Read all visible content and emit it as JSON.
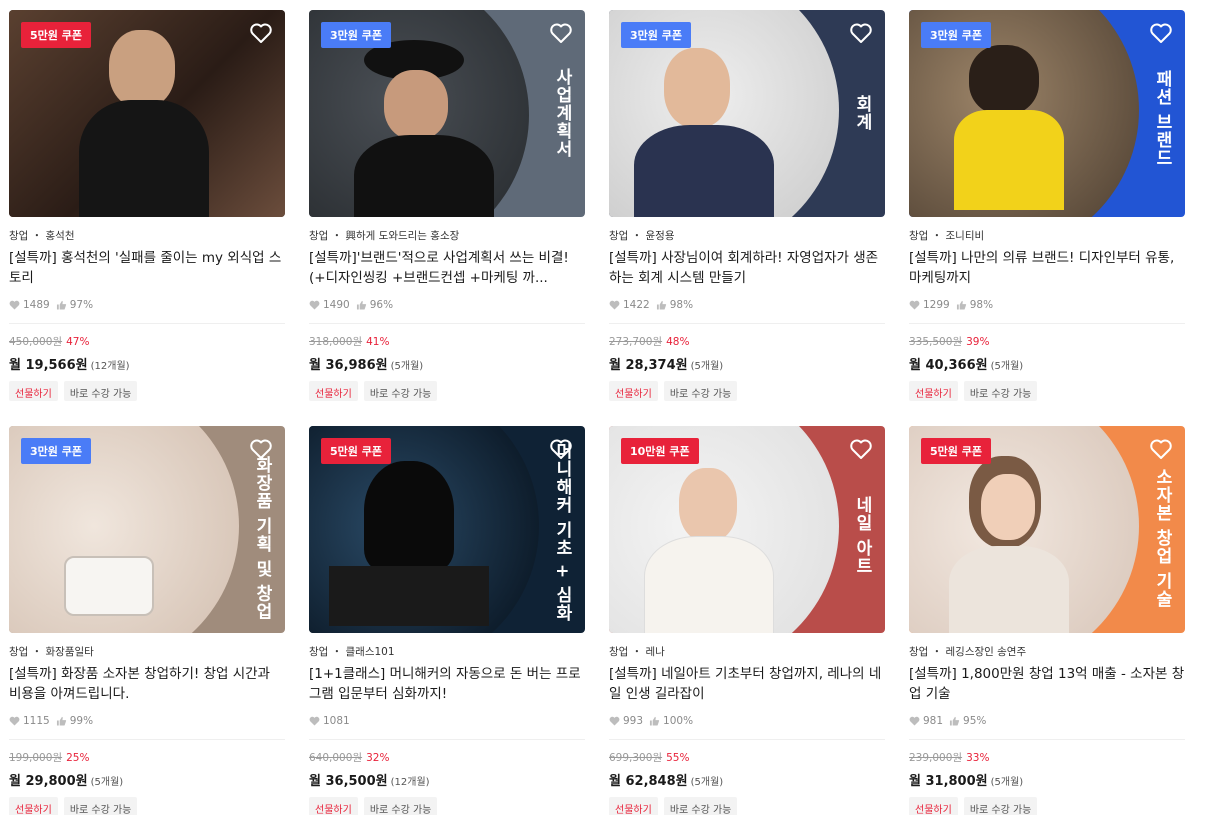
{
  "cards": [
    {
      "coupon": "5만원 쿠폰",
      "coupon_color": "#e8223a",
      "side_text": "",
      "meta": "창업 ・ 홍석천",
      "title": "[설특까] 홍석천의 '실패를 줄이는 my 외식업 스토리",
      "likes": "1489",
      "rating": "97%",
      "orig_price": "450,000원",
      "discount": "47%",
      "monthly": "월 19,566원",
      "months": "(12개월)",
      "gift": "선물하기",
      "now": "바로 수강 가능",
      "bg": "#3a2a22",
      "photo": "#6b4d3c"
    },
    {
      "coupon": "3만원 쿠폰",
      "coupon_color": "#4a7cf7",
      "side_text": "사업계획서",
      "meta": "창업 ・ 興하게 도와드리는 홍소장",
      "title": "[설특까]'브랜드'적으로 사업계획서 쓰는 비결! (+디자인씽킹 +브랜드컨셉 +마케팅 까...",
      "likes": "1490",
      "rating": "96%",
      "orig_price": "318,000원",
      "discount": "41%",
      "monthly": "월 36,986원",
      "months": "(5개월)",
      "gift": "선물하기",
      "now": "바로 수강 가능",
      "bg": "#5f6a78",
      "photo": "#2b2f33"
    },
    {
      "coupon": "3만원 쿠폰",
      "coupon_color": "#4a7cf7",
      "side_text": "회계",
      "meta": "창업 ・ 윤정용",
      "title": "[설특까] 사장님이여 회계하라! 자영업자가 생존하는 회계 시스템 만들기",
      "likes": "1422",
      "rating": "98%",
      "orig_price": "273,700원",
      "discount": "48%",
      "monthly": "월 28,374원",
      "months": "(5개월)",
      "gift": "선물하기",
      "now": "바로 수강 가능",
      "bg": "#2e3a55",
      "photo": "#d9d9d9"
    },
    {
      "coupon": "3만원 쿠폰",
      "coupon_color": "#4a7cf7",
      "side_text": "패션 브랜드",
      "meta": "창업 ・ 조니티비",
      "title": "[설특까] 나만의 의류 브랜드! 디자인부터 유통, 마케팅까지",
      "likes": "1299",
      "rating": "98%",
      "orig_price": "335,500원",
      "discount": "39%",
      "monthly": "월 40,366원",
      "months": "(5개월)",
      "gift": "선물하기",
      "now": "바로 수강 가능",
      "bg": "#2255d4",
      "photo": "#8a7258"
    },
    {
      "coupon": "3만원 쿠폰",
      "coupon_color": "#4a7cf7",
      "side_text": "화장품 기획 및 창업",
      "meta": "창업 ・ 화장품일타",
      "title": "[설특까] 화장품 소자본 창업하기! 창업 시간과 비용을 아껴드립니다.",
      "likes": "1115",
      "rating": "99%",
      "orig_price": "199,000원",
      "discount": "25%",
      "monthly": "월 29,800원",
      "months": "(5개월)",
      "gift": "선물하기",
      "now": "바로 수강 가능",
      "bg": "#a08c7c",
      "photo": "#e4d7cc"
    },
    {
      "coupon": "5만원 쿠폰",
      "coupon_color": "#e8223a",
      "side_text": "머니해커 기초 + 심화",
      "meta": "창업 ・ 클래스101",
      "title": "[1+1클래스] 머니해커의 자동으로 돈 버는 프로그램 입문부터 심화까지!",
      "likes": "1081",
      "rating": "",
      "orig_price": "640,000원",
      "discount": "32%",
      "monthly": "월 36,500원",
      "months": "(12개월)",
      "gift": "선물하기",
      "now": "바로 수강 가능",
      "bg": "#0f2235",
      "photo": "#1e3c55"
    },
    {
      "coupon": "10만원 쿠폰",
      "coupon_color": "#e8223a",
      "side_text": "네일 아트",
      "meta": "창업 ・ 레나",
      "title": "[설특까] 네일아트 기초부터 창업까지, 레나의 네일 인생 길라잡이",
      "likes": "993",
      "rating": "100%",
      "orig_price": "699,300원",
      "discount": "55%",
      "monthly": "월 62,848원",
      "months": "(5개월)",
      "gift": "선물하기",
      "now": "바로 수강 가능",
      "bg": "#b94d4a",
      "photo": "#eeeeee"
    },
    {
      "coupon": "5만원 쿠폰",
      "coupon_color": "#e8223a",
      "side_text": "소자본 창업 기술",
      "meta": "창업 ・ 레깅스장인 송연주",
      "title": "[설특까] 1,800만원 창업 13억 매출 - 소자본 창업 기술",
      "likes": "981",
      "rating": "95%",
      "orig_price": "239,000원",
      "discount": "33%",
      "monthly": "월 31,800원",
      "months": "(5개월)",
      "gift": "선물하기",
      "now": "바로 수강 가능",
      "bg": "#f28a4a",
      "photo": "#e9dcd3"
    }
  ]
}
